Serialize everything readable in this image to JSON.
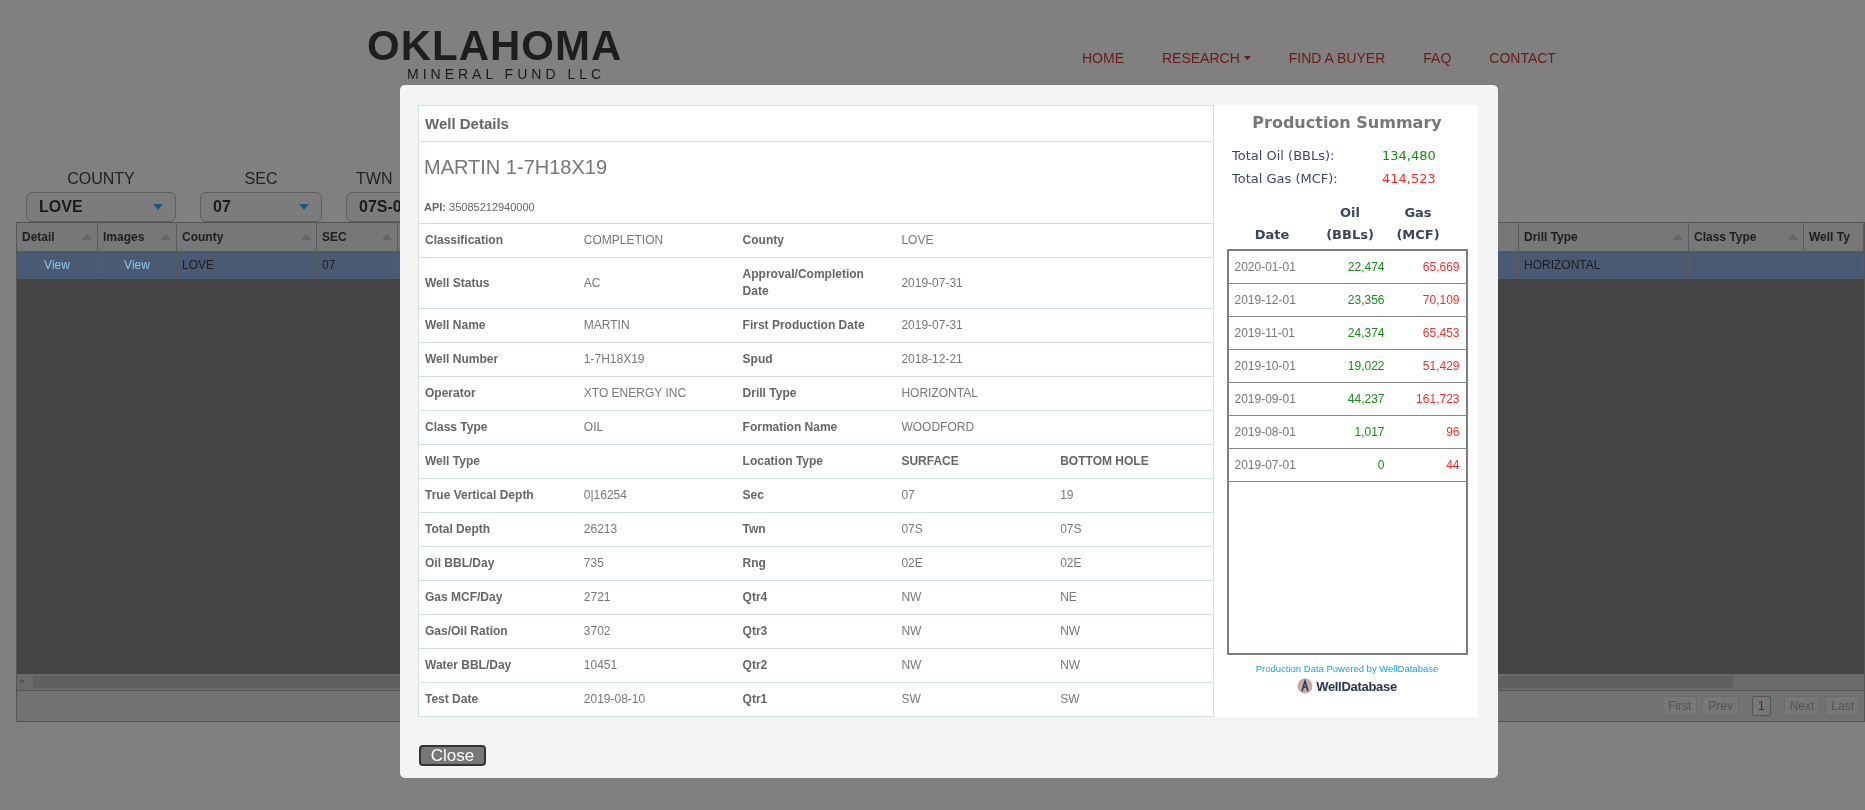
{
  "header": {
    "logo": {
      "title": "OKLAHOMA",
      "subtitle": "MINERAL FUND LLC"
    },
    "nav": [
      {
        "label": "HOME",
        "dropdown": false
      },
      {
        "label": "RESEARCH",
        "dropdown": true
      },
      {
        "label": "FIND A BUYER",
        "dropdown": false
      },
      {
        "label": "FAQ",
        "dropdown": false
      },
      {
        "label": "CONTACT",
        "dropdown": false
      }
    ]
  },
  "filters": [
    {
      "label": "COUNTY",
      "value": "LOVE"
    },
    {
      "label": "SEC",
      "value": "07"
    },
    {
      "label": "TWN",
      "value": "07S-0"
    }
  ],
  "grid": {
    "columns": [
      {
        "label": "Detail",
        "sortable": true
      },
      {
        "label": "Images",
        "sortable": true
      },
      {
        "label": "County",
        "sortable": true
      },
      {
        "label": "SEC",
        "sortable": true
      },
      {
        "label": "Drill Type",
        "sortable": true
      },
      {
        "label": "Class Type",
        "sortable": true
      },
      {
        "label": "Well Ty",
        "sortable": false
      }
    ],
    "rows": [
      {
        "selected": true,
        "cells": [
          {
            "kind": "link",
            "text": "View"
          },
          {
            "kind": "link",
            "text": "View"
          },
          {
            "kind": "text",
            "text": "LOVE"
          },
          {
            "kind": "text",
            "text": "07"
          },
          {
            "kind": "text",
            "text": "HORIZONTAL"
          },
          null,
          null
        ]
      }
    ],
    "pager": [
      {
        "label": "First",
        "selected": false
      },
      {
        "label": "Prev",
        "selected": false
      },
      {
        "label": "1",
        "selected": true
      },
      {
        "label": "Next",
        "selected": false
      },
      {
        "label": "Last",
        "selected": false
      }
    ]
  },
  "modal": {
    "well_details": {
      "title": "Well Details",
      "well_name": "MARTIN 1-7H18X19",
      "api_label": "API:",
      "api": "35085212940000",
      "rows": [
        [
          {
            "kind": "label",
            "text": "Classification"
          },
          {
            "kind": "value",
            "text": "COMPLETION"
          },
          {
            "kind": "label",
            "text": "County"
          },
          {
            "kind": "value",
            "text": "LOVE"
          },
          null
        ],
        [
          {
            "kind": "label",
            "text": "Well Status"
          },
          {
            "kind": "value",
            "text": "AC"
          },
          {
            "kind": "label",
            "text": "Approval/Completion Date"
          },
          {
            "kind": "value",
            "text": "2019-07-31"
          },
          null
        ],
        [
          {
            "kind": "label",
            "text": "Well Name"
          },
          {
            "kind": "value",
            "text": "MARTIN"
          },
          {
            "kind": "label",
            "text": "First Production Date"
          },
          {
            "kind": "value",
            "text": "2019-07-31"
          },
          null
        ],
        [
          {
            "kind": "label",
            "text": "Well Number"
          },
          {
            "kind": "value",
            "text": "1-7H18X19"
          },
          {
            "kind": "label",
            "text": "Spud"
          },
          {
            "kind": "value",
            "text": "2018-12-21"
          },
          null
        ],
        [
          {
            "kind": "label",
            "text": "Operator"
          },
          {
            "kind": "value",
            "text": "XTO ENERGY INC"
          },
          {
            "kind": "label",
            "text": "Drill Type"
          },
          {
            "kind": "value",
            "text": "HORIZONTAL"
          },
          null
        ],
        [
          {
            "kind": "label",
            "text": "Class Type"
          },
          {
            "kind": "value",
            "text": "OIL"
          },
          {
            "kind": "label",
            "text": "Formation Name"
          },
          {
            "kind": "value",
            "text": "WOODFORD"
          },
          null
        ],
        [
          {
            "kind": "label",
            "text": "Well Type"
          },
          null,
          {
            "kind": "label",
            "text": "Location Type"
          },
          {
            "kind": "label",
            "text": "SURFACE"
          },
          {
            "kind": "label",
            "text": "BOTTOM HOLE"
          }
        ],
        [
          {
            "kind": "label",
            "text": "True Vertical Depth"
          },
          {
            "kind": "value",
            "text": "0|16254"
          },
          {
            "kind": "label",
            "text": "Sec"
          },
          {
            "kind": "value",
            "text": "07"
          },
          {
            "kind": "value",
            "text": "19"
          }
        ],
        [
          {
            "kind": "label",
            "text": "Total Depth"
          },
          {
            "kind": "value",
            "text": "26213"
          },
          {
            "kind": "label",
            "text": "Twn"
          },
          {
            "kind": "value",
            "text": "07S"
          },
          {
            "kind": "value",
            "text": "07S"
          }
        ],
        [
          {
            "kind": "label",
            "text": "Oil BBL/Day"
          },
          {
            "kind": "value",
            "text": "735"
          },
          {
            "kind": "label",
            "text": "Rng"
          },
          {
            "kind": "value",
            "text": "02E"
          },
          {
            "kind": "value",
            "text": "02E"
          }
        ],
        [
          {
            "kind": "label",
            "text": "Gas MCF/Day"
          },
          {
            "kind": "value",
            "text": "2721"
          },
          {
            "kind": "label",
            "text": "Qtr4"
          },
          {
            "kind": "value",
            "text": "NW"
          },
          {
            "kind": "value",
            "text": "NE"
          }
        ],
        [
          {
            "kind": "label",
            "text": "Gas/Oil Ration"
          },
          {
            "kind": "value",
            "text": "3702"
          },
          {
            "kind": "label",
            "text": "Qtr3"
          },
          {
            "kind": "value",
            "text": "NW"
          },
          {
            "kind": "value",
            "text": "NW"
          }
        ],
        [
          {
            "kind": "label",
            "text": "Water BBL/Day"
          },
          {
            "kind": "value",
            "text": "10451"
          },
          {
            "kind": "label",
            "text": "Qtr2"
          },
          {
            "kind": "value",
            "text": "NW"
          },
          {
            "kind": "value",
            "text": "NW"
          }
        ],
        [
          {
            "kind": "label",
            "text": "Test Date"
          },
          {
            "kind": "value",
            "text": "2019-08-10"
          },
          {
            "kind": "label",
            "text": "Qtr1"
          },
          {
            "kind": "value",
            "text": "SW"
          },
          {
            "kind": "value",
            "text": "SW"
          }
        ]
      ]
    },
    "production": {
      "title": "Production Summary",
      "totals": [
        {
          "kind": "oil",
          "label": "Total Oil (BBLs):",
          "value": "134,480"
        },
        {
          "kind": "gas",
          "label": "Total Gas (MCF):",
          "value": "414,523"
        }
      ],
      "columns": [
        "Date",
        "Oil (BBLs)",
        "Gas (MCF)"
      ],
      "rows": [
        {
          "date": "2020-01-01",
          "oil": "22,474",
          "gas": "65,669"
        },
        {
          "date": "2019-12-01",
          "oil": "23,356",
          "gas": "70,109"
        },
        {
          "date": "2019-11-01",
          "oil": "24,374",
          "gas": "65,453"
        },
        {
          "date": "2019-10-01",
          "oil": "19,022",
          "gas": "51,429"
        },
        {
          "date": "2019-09-01",
          "oil": "44,237",
          "gas": "161,723"
        },
        {
          "date": "2019-08-01",
          "oil": "1,017",
          "gas": "96"
        },
        {
          "date": "2019-07-01",
          "oil": "0",
          "gas": "44"
        }
      ],
      "credit": "Production Data Powered by WellDatabase",
      "credit_logo": "WellDatabase"
    },
    "close_button": "Close"
  }
}
